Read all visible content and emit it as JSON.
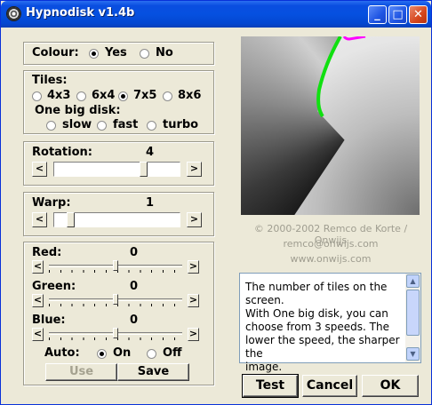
{
  "window": {
    "title": "Hypnodisk v1.4b"
  },
  "titlebar_buttons": {
    "minimize": "_",
    "maximize": "□",
    "close": "✕"
  },
  "colour": {
    "label": "Colour:",
    "yes": "Yes",
    "no": "No",
    "selected": "Yes"
  },
  "tiles": {
    "label": "Tiles:",
    "options": [
      "4x3",
      "6x4",
      "7x5",
      "8x6"
    ],
    "selected": "7x5",
    "big_disk_label": "One big disk:",
    "speeds": [
      "slow",
      "fast",
      "turbo"
    ]
  },
  "rotation": {
    "label": "Rotation:",
    "value": "4"
  },
  "warp": {
    "label": "Warp:",
    "value": "1"
  },
  "colors": {
    "red": {
      "label": "Red:",
      "value": "0"
    },
    "green": {
      "label": "Green:",
      "value": "0"
    },
    "blue": {
      "label": "Blue:",
      "value": "0"
    }
  },
  "auto": {
    "label": "Auto:",
    "on": "On",
    "off": "Off",
    "selected": "On"
  },
  "buttons": {
    "use": "Use",
    "save": "Save",
    "test": "Test",
    "cancel": "Cancel",
    "ok": "OK"
  },
  "slider_arrows": {
    "left": "<",
    "right": ">"
  },
  "credits": {
    "line1": "© 2000-2002 Remco de Korte / Onwijs",
    "line2": "remco@onwijs.com",
    "line3": "www.onwijs.com"
  },
  "help_text": {
    "line1": "The number of tiles on the",
    "line2": "screen.",
    "line3": "With One big disk, you can",
    "line4": "choose from 3 speeds. The",
    "line5": "lower the speed, the sharper the",
    "line6": "image."
  },
  "accent_colors": {
    "title_bar": "#0550e0",
    "preview_edge_green": "#10e010",
    "preview_edge_magenta": "#ff00ff"
  }
}
